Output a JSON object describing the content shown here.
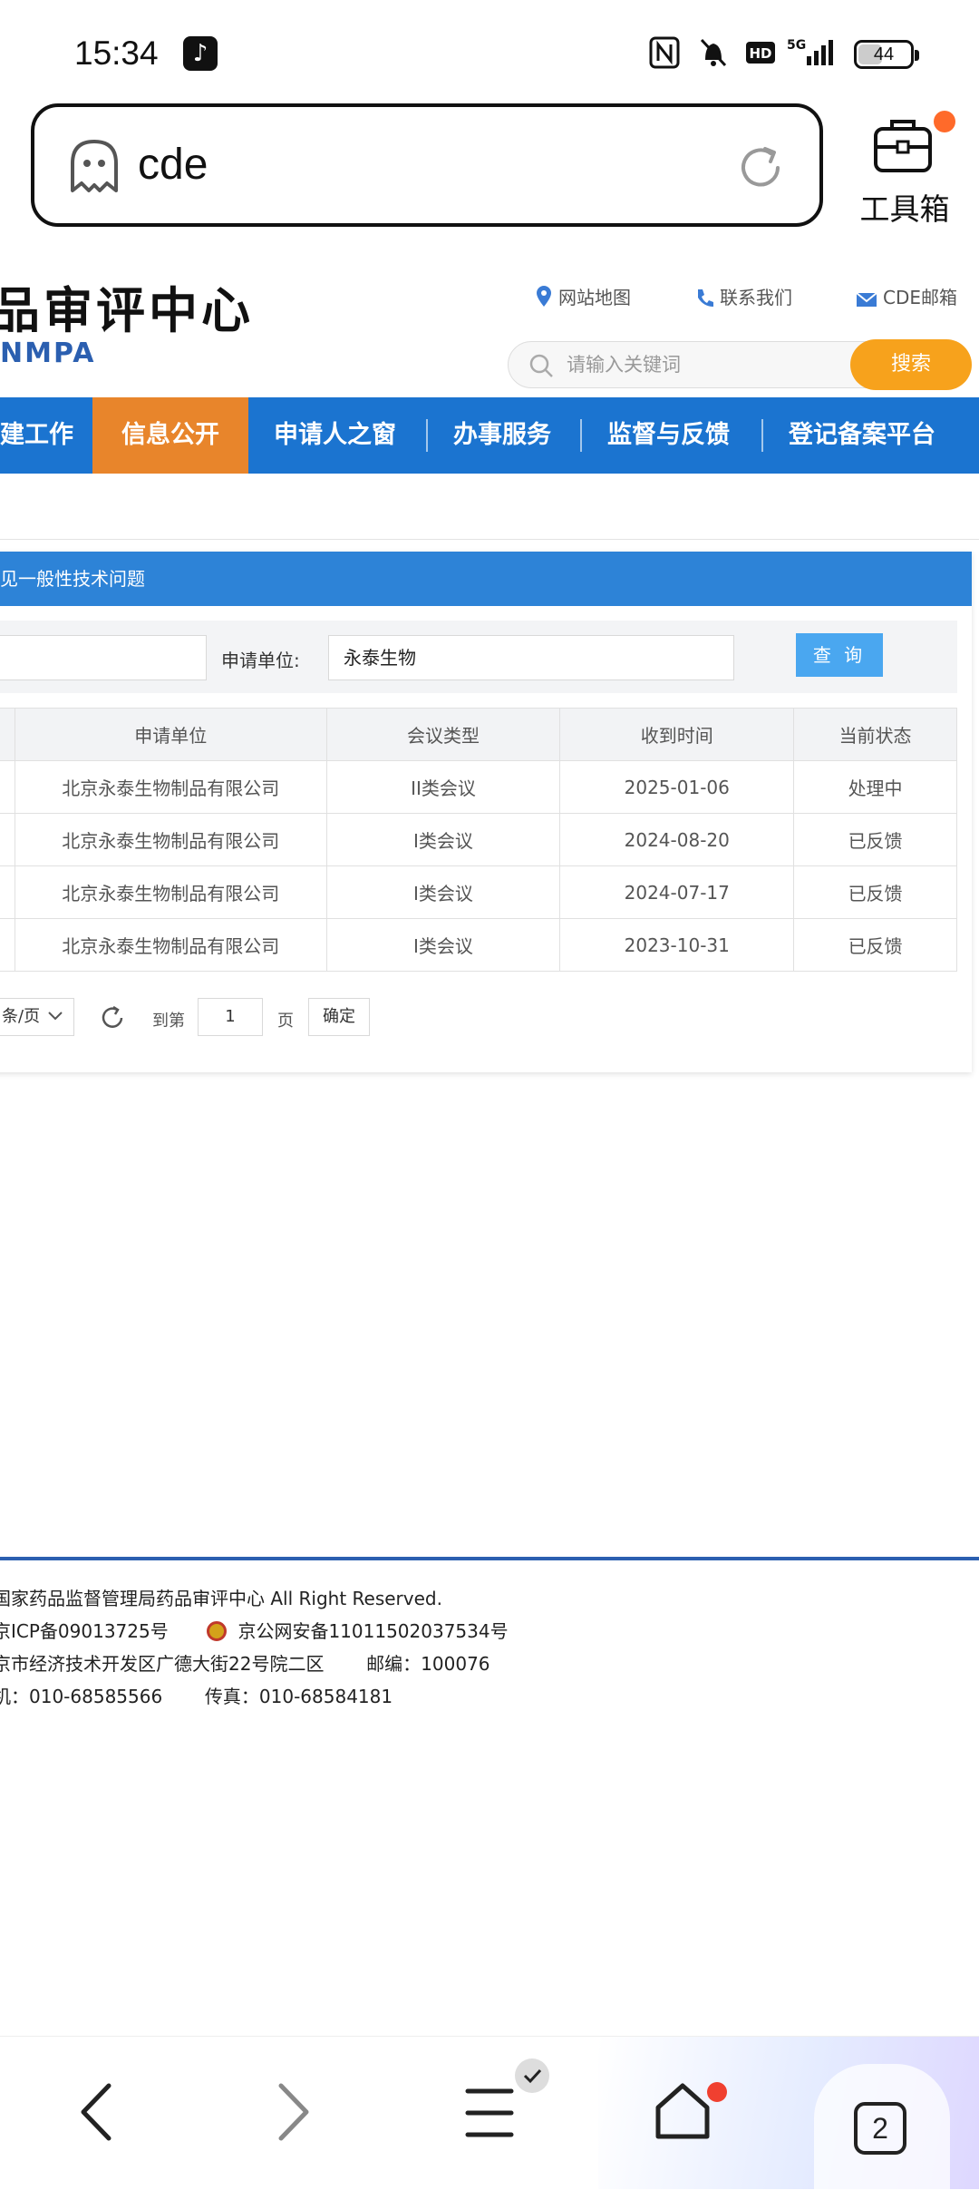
{
  "status_bar": {
    "time": "15:34",
    "battery": "44",
    "network": "5G"
  },
  "browser": {
    "url_text": "cde",
    "toolbox_label": "工具箱"
  },
  "site": {
    "title": "品审评中心",
    "subtitle": "NMPA",
    "links": {
      "sitemap": "网站地图",
      "contact": "联系我们",
      "mail": "CDE邮箱"
    },
    "search_placeholder": "请输入关键词",
    "search_button": "搜索"
  },
  "nav": {
    "items": [
      {
        "label": "建工作"
      },
      {
        "label": "信息公开"
      },
      {
        "label": "申请人之窗"
      },
      {
        "label": "办事服务"
      },
      {
        "label": "监督与反馈"
      },
      {
        "label": "登记备案平台"
      }
    ],
    "active_index": 1,
    "colors": {
      "bar": "#1b74d0",
      "active": "#e8852b"
    }
  },
  "panel": {
    "header": "见一般性技术问题",
    "filter_label": "申请单位:",
    "filter_value": "永泰生物",
    "query_button": "查 询"
  },
  "table": {
    "headers": [
      "申请单位",
      "会议类型",
      "收到时间",
      "当前状态"
    ],
    "rows": [
      [
        "北京永泰生物制品有限公司",
        "II类会议",
        "2025-01-06",
        "处理中"
      ],
      [
        "北京永泰生物制品有限公司",
        "I类会议",
        "2024-08-20",
        "已反馈"
      ],
      [
        "北京永泰生物制品有限公司",
        "I类会议",
        "2024-07-17",
        "已反馈"
      ],
      [
        "北京永泰生物制品有限公司",
        "I类会议",
        "2023-10-31",
        "已反馈"
      ]
    ]
  },
  "pagination": {
    "page_size_label": "条/页",
    "goto_label": "到第",
    "page_value": "1",
    "page_suffix": "页",
    "confirm": "确定"
  },
  "footer": {
    "line1": "国家药品监督管理局药品审评中心   All Right Reserved.",
    "icp": "京ICP备09013725号",
    "police": "京公网安备11011502037534号",
    "address": "京市经济技术开发区广德大街22号院二区",
    "postcode": "邮编：100076",
    "phone": "机：010-68585566",
    "fax": "传真：010-68584181"
  },
  "bottom_nav": {
    "tab_count": "2"
  }
}
